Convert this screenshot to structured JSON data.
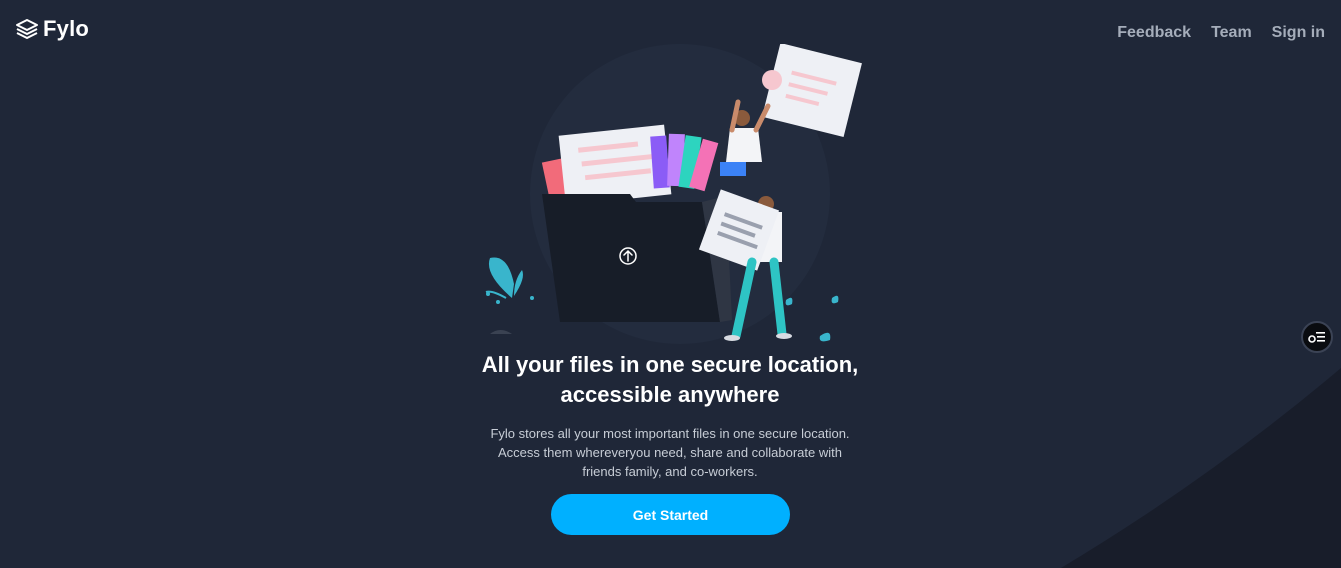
{
  "brand": {
    "name": "Fylo",
    "logo_icon": "stacked-layers-icon"
  },
  "nav": {
    "items": [
      {
        "label": "Feedback"
      },
      {
        "label": "Team"
      },
      {
        "label": "Sign in"
      }
    ]
  },
  "hero": {
    "illustration_icon": "upload-icon",
    "title_line1": "All your files in one secure location,",
    "title_line2": "accessible anywhere",
    "desc_line1": "Fylo stores all your most important files in one secure location.",
    "desc_line2": "Access them whereveryou need, share and collaborate with",
    "desc_line3": "friends family, and co-workers.",
    "cta_label": "Get Started"
  },
  "side_widget": {
    "icon": "toggle-list-icon"
  },
  "colors": {
    "background": "#1f2738",
    "accent": "#00b0ff",
    "nav_text": "#a5adba",
    "body_text": "#c7cdd6"
  }
}
